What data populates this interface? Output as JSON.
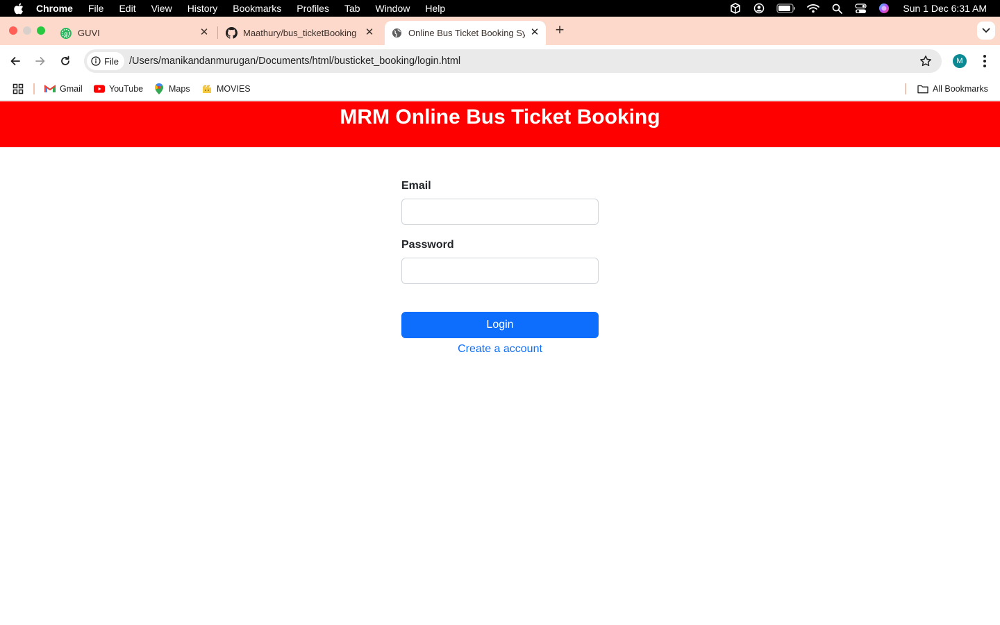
{
  "menubar": {
    "app_name": "Chrome",
    "items": [
      "File",
      "Edit",
      "View",
      "History",
      "Bookmarks",
      "Profiles",
      "Tab",
      "Window",
      "Help"
    ],
    "clock": "Sun 1 Dec  6:31 AM",
    "status_icons": [
      "box-icon",
      "user-circle-icon",
      "battery-icon",
      "wifi-icon",
      "spotlight-search-icon",
      "control-center-icon",
      "siri-icon"
    ]
  },
  "tabs": [
    {
      "title": "GUVI",
      "icon": "guvi-icon",
      "active": false
    },
    {
      "title": "Maathury/bus_ticketBooking",
      "icon": "github-icon",
      "active": false
    },
    {
      "title": "Online Bus Ticket Booking Sy",
      "icon": "globe-icon",
      "active": true
    }
  ],
  "toolbar": {
    "chip_label": "File",
    "url": "/Users/manikandanmurugan/Documents/html/busticket_booking/login.html",
    "profile_initial": "M"
  },
  "bookmarks": {
    "items": [
      {
        "label": "Gmail",
        "icon": "gmail-icon"
      },
      {
        "label": "YouTube",
        "icon": "youtube-icon"
      },
      {
        "label": "Maps",
        "icon": "maps-icon"
      },
      {
        "label": "MOVIES",
        "icon": "movies-icon"
      }
    ],
    "all_bookmarks": "All Bookmarks"
  },
  "page": {
    "header_title": "MRM Online Bus Ticket Booking",
    "email_label": "Email",
    "email_value": "",
    "password_label": "Password",
    "password_value": "",
    "login_button": "Login",
    "create_account_link": "Create a account"
  },
  "colors": {
    "header_bg": "#ff0000",
    "primary": "#0d6efd",
    "tabstrip_bg": "#fdd9cb"
  }
}
